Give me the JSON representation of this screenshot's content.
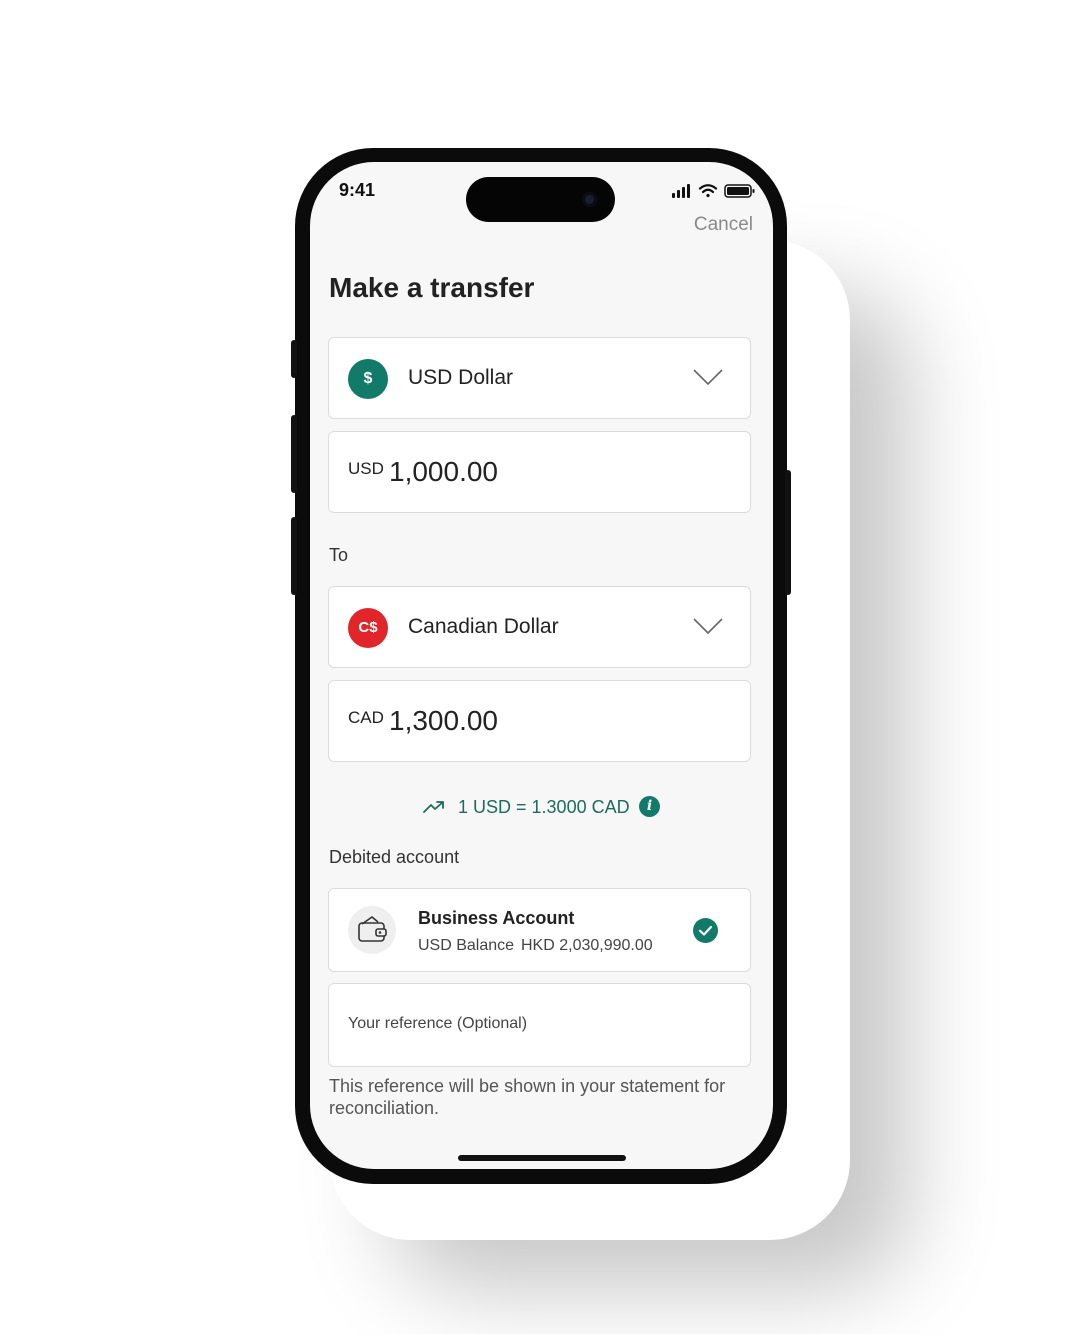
{
  "status_bar": {
    "time": "9:41"
  },
  "header": {
    "cancel_label": "Cancel",
    "title": "Make a transfer"
  },
  "from": {
    "currency_icon_text": "$",
    "currency_icon_color": "#127a69",
    "currency_label": "USD Dollar",
    "amount_code": "USD",
    "amount_value": "1,000.00"
  },
  "to_label": "To",
  "to": {
    "currency_icon_text": "C$",
    "currency_icon_color": "#e0262b",
    "currency_label": "Canadian Dollar",
    "amount_code": "CAD",
    "amount_value": "1,300.00"
  },
  "rate": {
    "text": "1 USD = 1.3000 CAD",
    "info_icon": "i"
  },
  "debited": {
    "label": "Debited account",
    "account_name": "Business Account",
    "balance_label": "USD Balance",
    "balance_value": "HKD 2,030,990.00"
  },
  "reference": {
    "placeholder": "Your reference (Optional)",
    "hint": "This reference will be shown in your statement for reconciliation."
  },
  "colors": {
    "accent": "#127a69",
    "cad_red": "#e0262b"
  }
}
